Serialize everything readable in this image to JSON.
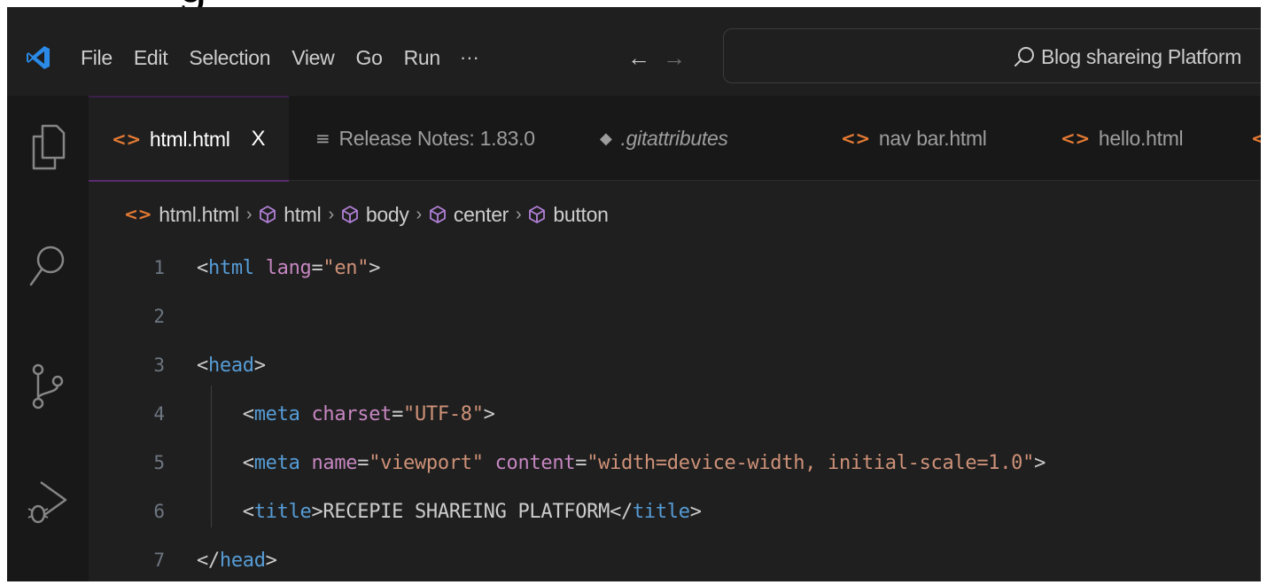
{
  "top_glyph": "g",
  "menu": {
    "items": [
      "File",
      "Edit",
      "Selection",
      "View",
      "Go",
      "Run"
    ],
    "more": "···"
  },
  "nav": {
    "back": "←",
    "forward": "→"
  },
  "command_center": {
    "label": "Blog shareing Platform"
  },
  "tabs": [
    {
      "label": "html.html",
      "icon": "code-icon",
      "active": true,
      "close": "X"
    },
    {
      "label": "Release Notes: 1.83.0",
      "icon": "release-notes-icon",
      "active": false
    },
    {
      "label": ".gitattributes",
      "icon": "git-icon",
      "active": false
    },
    {
      "label": "nav bar.html",
      "icon": "code-icon",
      "active": false
    },
    {
      "label": "hello.html",
      "icon": "code-icon",
      "active": false
    }
  ],
  "breadcrumb": [
    "html.html",
    "html",
    "body",
    "center",
    "button"
  ],
  "editor": {
    "line_numbers": [
      "1",
      "2",
      "3",
      "4",
      "5",
      "6",
      "7"
    ],
    "lines": [
      [
        [
          "<",
          "punc"
        ],
        [
          "html",
          "tag"
        ],
        [
          " ",
          "text"
        ],
        [
          "lang",
          "attr"
        ],
        [
          "=",
          "eq"
        ],
        [
          "\"en\"",
          "str"
        ],
        [
          ">",
          "punc"
        ]
      ],
      [],
      [
        [
          "<",
          "punc"
        ],
        [
          "head",
          "tag"
        ],
        [
          ">",
          "punc"
        ]
      ],
      [
        [
          "    <",
          "punc"
        ],
        [
          "meta",
          "tag"
        ],
        [
          " ",
          "text"
        ],
        [
          "charset",
          "attr"
        ],
        [
          "=",
          "eq"
        ],
        [
          "\"UTF-8\"",
          "str"
        ],
        [
          ">",
          "punc"
        ]
      ],
      [
        [
          "    <",
          "punc"
        ],
        [
          "meta",
          "tag"
        ],
        [
          " ",
          "text"
        ],
        [
          "name",
          "attr"
        ],
        [
          "=",
          "eq"
        ],
        [
          "\"viewport\"",
          "str"
        ],
        [
          " ",
          "text"
        ],
        [
          "content",
          "attr"
        ],
        [
          "=",
          "eq"
        ],
        [
          "\"width=device-width, initial-scale=1.0\"",
          "str"
        ],
        [
          ">",
          "punc"
        ]
      ],
      [
        [
          "    <",
          "punc"
        ],
        [
          "title",
          "tag"
        ],
        [
          ">",
          "punc"
        ],
        [
          "RECEPIE SHAREING PLATFORM",
          "text"
        ],
        [
          "</",
          "punc"
        ],
        [
          "title",
          "tag"
        ],
        [
          ">",
          "punc"
        ]
      ],
      [
        [
          "</",
          "punc"
        ],
        [
          "head",
          "tag"
        ],
        [
          ">",
          "punc"
        ]
      ]
    ]
  },
  "colors": {
    "background": "#1f1f1f",
    "activity_bar": "#181818",
    "tag": "#569cd6",
    "attr": "#c586c0",
    "string": "#ce9178",
    "html_icon": "#e37933",
    "line_number": "#6e7681"
  }
}
